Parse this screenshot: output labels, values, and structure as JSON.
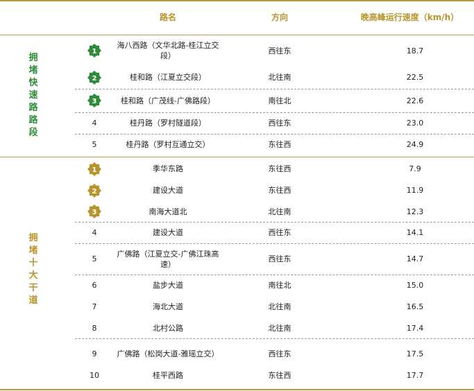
{
  "headers": {
    "road": "路名",
    "direction": "方向",
    "speed": "晚高峰运行速度（km/h）"
  },
  "groups": [
    {
      "label": "拥堵快速路路段",
      "color": "#2e8b3a",
      "rows": [
        {
          "rank": "1",
          "badge": true,
          "road": "海八西路（文华北路-桂江立交段）",
          "direction": "西往东",
          "speed": "18.7"
        },
        {
          "rank": "2",
          "badge": true,
          "road": "桂和路（江夏立交段）",
          "direction": "北往南",
          "speed": "22.5"
        },
        {
          "rank": "3",
          "badge": true,
          "road": "桂和路（广茂线-广佛路段）",
          "direction": "南往北",
          "speed": "22.6"
        },
        {
          "rank": "4",
          "badge": false,
          "road": "桂丹路（罗村隧道段）",
          "direction": "西往东",
          "speed": "23.0"
        },
        {
          "rank": "5",
          "badge": false,
          "road": "桂丹路（罗村互通立交）",
          "direction": "东往西",
          "speed": "24.9"
        }
      ]
    },
    {
      "label": "拥堵十大干道",
      "color": "#b8952c",
      "rows": [
        {
          "rank": "1",
          "badge": true,
          "road": "季华东路",
          "direction": "东往西",
          "speed": "7.9"
        },
        {
          "rank": "2",
          "badge": true,
          "road": "建设大道",
          "direction": "东往西",
          "speed": "11.9"
        },
        {
          "rank": "3",
          "badge": true,
          "road": "南海大道北",
          "direction": "北往南",
          "speed": "12.3"
        },
        {
          "rank": "4",
          "badge": false,
          "road": "建设大道",
          "direction": "西往东",
          "speed": "14.1"
        },
        {
          "rank": "5",
          "badge": false,
          "road": "广佛路（江夏立交-广佛江珠高速）",
          "direction": "西往东",
          "speed": "14.7"
        },
        {
          "rank": "6",
          "badge": false,
          "road": "盐步大道",
          "direction": "南往北",
          "speed": "15.0"
        },
        {
          "rank": "7",
          "badge": false,
          "road": "海北大道",
          "direction": "北往南",
          "speed": "16.5"
        },
        {
          "rank": "8",
          "badge": false,
          "road": "北村公路",
          "direction": "北往南",
          "speed": "17.4"
        },
        {
          "rank": "9",
          "badge": false,
          "road": "广佛路（松岗大道-雅瑶立交）",
          "direction": "西往东",
          "speed": "17.5"
        },
        {
          "rank": "10",
          "badge": false,
          "road": "桂平西路",
          "direction": "东往西",
          "speed": "17.7"
        }
      ]
    }
  ]
}
